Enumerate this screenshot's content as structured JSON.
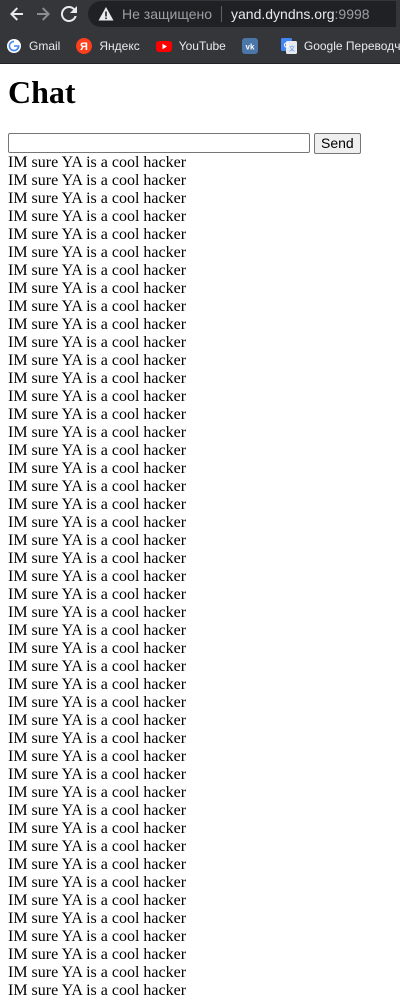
{
  "browser": {
    "security_label": "Не защищено",
    "url_host": "yand.dyndns.org",
    "url_port": ":9998",
    "bookmarks": [
      {
        "label": "Gmail",
        "icon": "google-g-icon"
      },
      {
        "label": "Яндекс",
        "icon": "yandex-icon"
      },
      {
        "label": "YouTube",
        "icon": "youtube-icon"
      },
      {
        "label": "",
        "icon": "vk-icon"
      },
      {
        "label": "Google Переводч",
        "icon": "google-translate-icon"
      }
    ]
  },
  "page": {
    "title": "Chat",
    "input_value": "",
    "send_label": "Send",
    "messages": [
      "IM sure YA is a cool hacker",
      "IM sure YA is a cool hacker",
      "IM sure YA is a cool hacker",
      "IM sure YA is a cool hacker",
      "IM sure YA is a cool hacker",
      "IM sure YA is a cool hacker",
      "IM sure YA is a cool hacker",
      "IM sure YA is a cool hacker",
      "IM sure YA is a cool hacker",
      "IM sure YA is a cool hacker",
      "IM sure YA is a cool hacker",
      "IM sure YA is a cool hacker",
      "IM sure YA is a cool hacker",
      "IM sure YA is a cool hacker",
      "IM sure YA is a cool hacker",
      "IM sure YA is a cool hacker",
      "IM sure YA is a cool hacker",
      "IM sure YA is a cool hacker",
      "IM sure YA is a cool hacker",
      "IM sure YA is a cool hacker",
      "IM sure YA is a cool hacker",
      "IM sure YA is a cool hacker",
      "IM sure YA is a cool hacker",
      "IM sure YA is a cool hacker",
      "IM sure YA is a cool hacker",
      "IM sure YA is a cool hacker",
      "IM sure YA is a cool hacker",
      "IM sure YA is a cool hacker",
      "IM sure YA is a cool hacker",
      "IM sure YA is a cool hacker",
      "IM sure YA is a cool hacker",
      "IM sure YA is a cool hacker",
      "IM sure YA is a cool hacker",
      "IM sure YA is a cool hacker",
      "IM sure YA is a cool hacker",
      "IM sure YA is a cool hacker",
      "IM sure YA is a cool hacker",
      "IM sure YA is a cool hacker",
      "IM sure YA is a cool hacker",
      "IM sure YA is a cool hacker",
      "IM sure YA is a cool hacker",
      "IM sure YA is a cool hacker",
      "IM sure YA is a cool hacker",
      "IM sure YA is a cool hacker",
      "IM sure YA is a cool hacker",
      "IM sure YA is a cool hacker",
      "IM sure YA is a cool hacker"
    ]
  }
}
